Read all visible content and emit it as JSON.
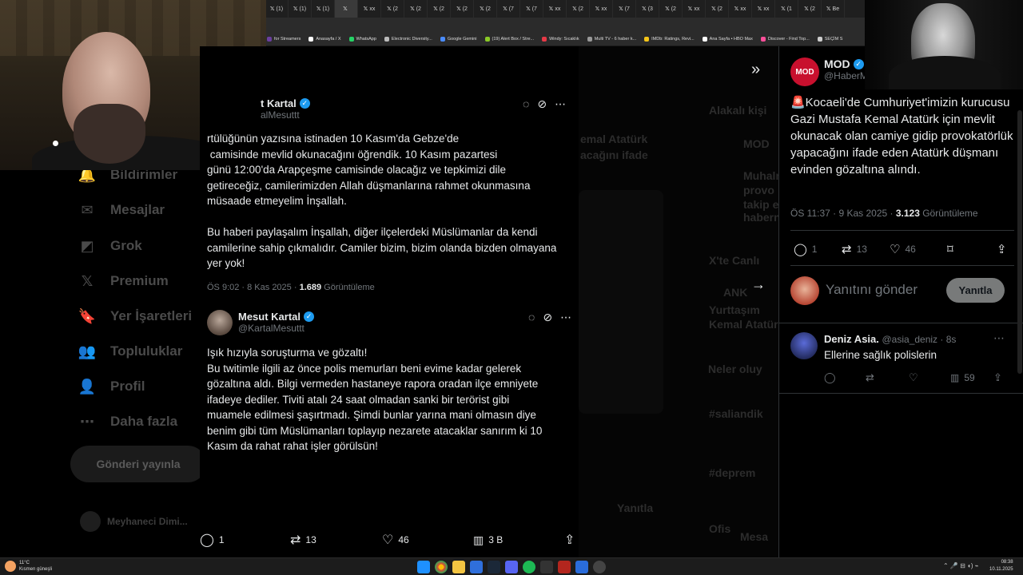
{
  "browser": {
    "tabs": [
      {
        "label": "(1)",
        "active": false
      },
      {
        "label": "(1)",
        "active": false
      },
      {
        "label": "(1)",
        "active": false
      },
      {
        "label": "",
        "active": true
      },
      {
        "label": "xx",
        "active": false
      },
      {
        "label": "(2",
        "active": false
      },
      {
        "label": "(2",
        "active": false
      },
      {
        "label": "(2",
        "active": false
      },
      {
        "label": "(2",
        "active": false
      },
      {
        "label": "(2",
        "active": false
      },
      {
        "label": "(7",
        "active": false
      },
      {
        "label": "(7",
        "active": false
      },
      {
        "label": "xx",
        "active": false
      },
      {
        "label": "(2",
        "active": false
      },
      {
        "label": "xx",
        "active": false
      },
      {
        "label": "(7",
        "active": false
      },
      {
        "label": "(3",
        "active": false
      },
      {
        "label": "(2",
        "active": false
      },
      {
        "label": "xx",
        "active": false
      },
      {
        "label": "(2",
        "active": false
      },
      {
        "label": "xx",
        "active": false
      },
      {
        "label": "xx",
        "active": false
      },
      {
        "label": "(1",
        "active": false
      },
      {
        "label": "(2",
        "active": false
      },
      {
        "label": "Be",
        "active": false
      }
    ],
    "bookmarks": [
      {
        "label": "for Streamers",
        "color": "#6b3fa0"
      },
      {
        "label": "Anasayfa / X",
        "color": "#ffffff"
      },
      {
        "label": "WhatsApp",
        "color": "#25d366"
      },
      {
        "label": "Electronic Diversity...",
        "color": "#bbbbbb"
      },
      {
        "label": "Google Gemini",
        "color": "#4a8cff"
      },
      {
        "label": "(19) Alert Box / Stre...",
        "color": "#8ac926"
      },
      {
        "label": "Windy: Sıcaklık",
        "color": "#e63946"
      },
      {
        "label": "Multi TV - 6 haber k...",
        "color": "#999999"
      },
      {
        "label": "IMDb: Ratings, Revi...",
        "color": "#f5c518"
      },
      {
        "label": "Ana Sayfa • HBO Max",
        "color": "#ffffff"
      },
      {
        "label": "Discover - Find Top...",
        "color": "#ff4f9a"
      },
      {
        "label": "SEÇİM S",
        "color": "#cccccc"
      }
    ]
  },
  "left_nav": {
    "items": [
      {
        "label": "Bildirimler",
        "icon": "bell-icon",
        "glyph": "🔔"
      },
      {
        "label": "Mesajlar",
        "icon": "mail-icon",
        "glyph": "✉"
      },
      {
        "label": "Grok",
        "icon": "grok-icon",
        "glyph": "◩"
      },
      {
        "label": "Premium",
        "icon": "x-logo-icon",
        "glyph": "𝕏"
      },
      {
        "label": "Yer İşaretleri",
        "icon": "bookmark-icon",
        "glyph": "🔖"
      },
      {
        "label": "Topluluklar",
        "icon": "people-icon",
        "glyph": "👥"
      },
      {
        "label": "Profil",
        "icon": "person-icon",
        "glyph": "👤"
      },
      {
        "label": "Daha fazla",
        "icon": "more-icon",
        "glyph": "⋯"
      }
    ],
    "post_button": "Gönderi yayınla",
    "account_name": "Meyhaneci Dimi..."
  },
  "background_faint": {
    "words": [
      "emal Atatürk",
      "acağını ifade",
      "Alakalı kişi",
      "MOD",
      "Muhaln",
      "provo",
      "takip e",
      "habern",
      "X'te Canlı",
      "ANK",
      "Yurttaşım",
      "Kemal Atatürk",
      "Neler oluy",
      "#saliandik",
      "#deprem",
      "Ofis",
      "Mesa",
      "Yanıtla"
    ]
  },
  "tweet1": {
    "name": "t Kartal",
    "handle": "alMesuttt",
    "text": "rtülüğünün yazısına istinaden 10 Kasım'da Gebze'de\n camisinde mevlid okunacağını öğrendik. 10 Kasım pazartesi\ngünü 12:00'da Arapçeşme camisinde olacağız ve tepkimizi dile\ngetireceğiz, camilerimizden Allah düşmanlarına rahmet okunmasına\nmüsaade etmeyelim İnşallah.\n\nBu haberi paylaşalım İnşallah, diğer ilçelerdeki Müslümanlar da kendi\ncamilerine sahip çıkmalıdır. Camiler bizim, bizim olanda bizden olmayana\nyer yok!",
    "time": "ÖS 9:02 · 8 Kas 2025 · ",
    "views": "1.689",
    "views_label": " Görüntüleme"
  },
  "tweet2": {
    "name": "Mesut Kartal",
    "handle": "@KartalMesuttt",
    "text": "Işık hızıyla soruşturma ve gözaltı!\nBu twitimle ilgili az önce polis memurları beni evime kadar gelerek\ngözaltına aldı. Bilgi vermeden hastaneye rapora oradan ilçe emniyete\nifadeye dediler. Tiviti atalı 24 saat olmadan sanki bir terörist gibi\nmuamele edilmesi şaşırtmadı. Şimdi bunlar yarına mani olmasın diye\nbenim gibi tüm Müslümanları toplayıp nezarete atacaklar sanırım ki 10\nKasım da rahat rahat işler görülsün!"
  },
  "bottom_bar": {
    "replies": "1",
    "reposts": "13",
    "likes": "46",
    "views": "3 B"
  },
  "right": {
    "name": "MOD",
    "handle": "@HaberM",
    "text": "🚨Kocaeli'de Cumhuriyet'imizin kurucusu Gazi Mustafa Kemal Atatürk için mevlit okunacak olan camiye gidip provokatörlük yapacağını ifade eden Atatürk düşmanı evinden gözaltına alındı.",
    "time": "ÖS 11:37 · 9 Kas 2025 · ",
    "views": "3.123",
    "views_label": " Görüntüleme",
    "replies": "1",
    "reposts": "13",
    "likes": "46",
    "reply_placeholder": "Yanıtını gönder",
    "reply_button": "Yanıtla",
    "reply": {
      "name": "Deniz Asia.",
      "handle": "@asia_deniz · 8s",
      "text": "Ellerine sağlık polislerin",
      "views": "59"
    }
  },
  "taskbar": {
    "weather_temp": "11°C",
    "weather_desc": "Kısmen güneşli",
    "time": "08:38",
    "date": "10.11.2025"
  },
  "colors": {
    "accent": "#1d9bf0",
    "text": "#e7e9ea",
    "muted": "#71767b",
    "border": "#2f3336"
  }
}
